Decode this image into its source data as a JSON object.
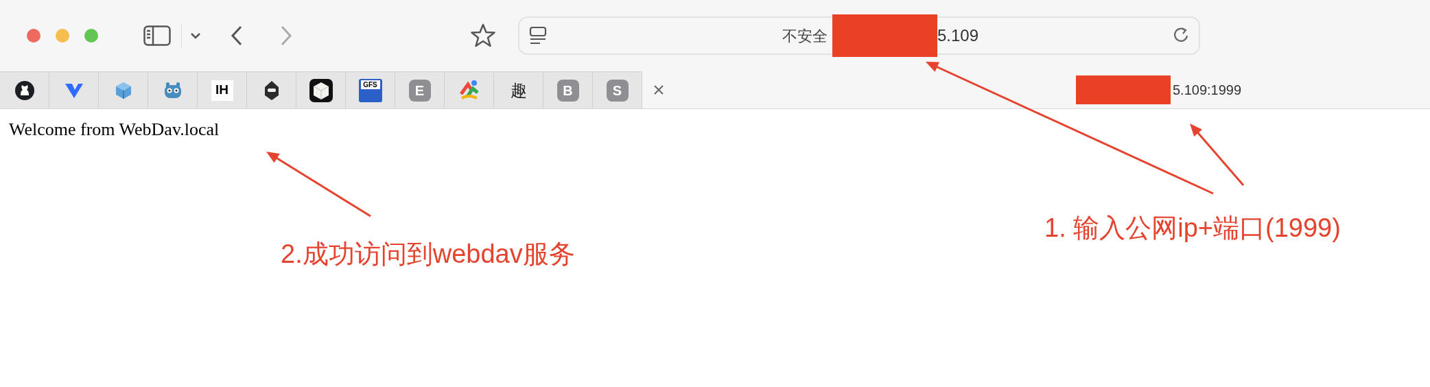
{
  "address_bar": {
    "security_label": "不安全",
    "redacted": true,
    "url_tail": "5.109"
  },
  "pinned_tabs": [
    {
      "kind": "github"
    },
    {
      "kind": "chevron"
    },
    {
      "kind": "cube"
    },
    {
      "kind": "robot"
    },
    {
      "kind": "tile",
      "text": "IH"
    },
    {
      "kind": "hooded"
    },
    {
      "kind": "box"
    },
    {
      "kind": "floppy",
      "text": "GFS"
    },
    {
      "kind": "badge",
      "text": "E"
    },
    {
      "kind": "swirl"
    },
    {
      "kind": "plain",
      "text": "趣"
    },
    {
      "kind": "badge",
      "text": "B"
    },
    {
      "kind": "badge",
      "text": "S"
    }
  ],
  "active_tab": {
    "redacted": true,
    "title_tail": "5.109:1999"
  },
  "page": {
    "text": "Welcome from WebDav.local"
  },
  "annotations": [
    {
      "text": "1. 输入公网ip+端口(1999)"
    },
    {
      "text": "2.成功访问到webdav服务"
    }
  ]
}
